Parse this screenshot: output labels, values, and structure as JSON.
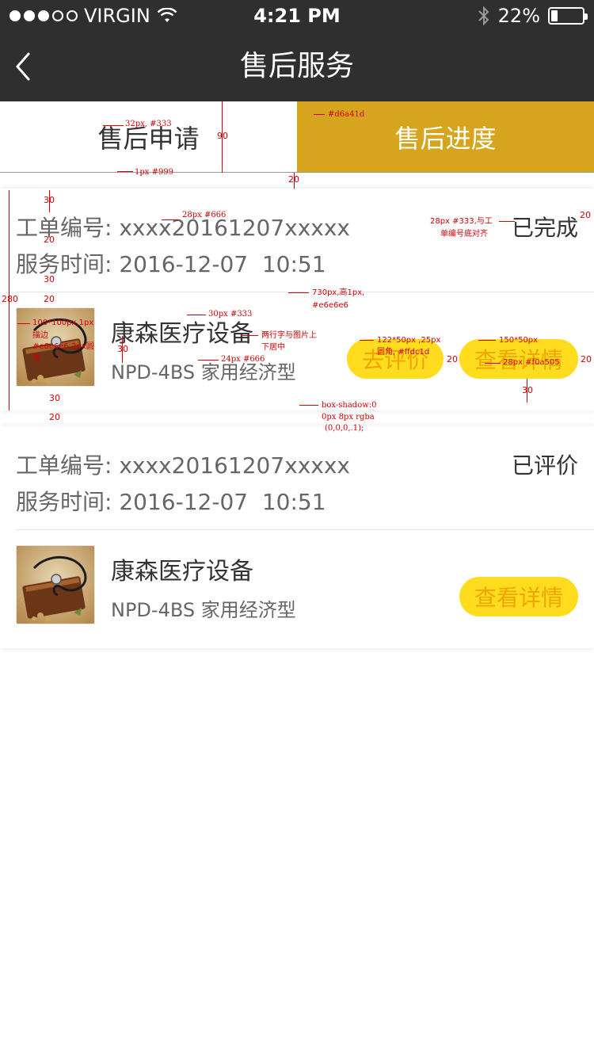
{
  "status_bar": {
    "carrier": "VIRGIN",
    "time": "4:21 PM",
    "battery": "22%",
    "battery_level": 0.22
  },
  "nav": {
    "title": "售后服务",
    "back_icon": "chevron-left-icon"
  },
  "tabs": [
    {
      "label": "售后申请",
      "active": false
    },
    {
      "label": "售后进度",
      "active": true
    }
  ],
  "orders": [
    {
      "order_no_label": "工单编号:",
      "order_no": "xxxx20161207xxxxx",
      "time_label": "服务时间:",
      "time": "2016-12-07  10:51",
      "status": "已完成",
      "product_name": "康森医疗设备",
      "product_model": "NPD-4BS 家用经济型",
      "review_button": "去评价",
      "detail_button": "查看详情"
    },
    {
      "order_no_label": "工单编号:",
      "order_no": "xxxx20161207xxxxx",
      "time_label": "服务时间:",
      "time": "2016-12-07  10:51",
      "status": "已评价",
      "product_name": "康森医疗设备",
      "product_model": "NPD-4BS 家用经济型",
      "detail_button": "查看详情"
    }
  ],
  "annotations": {
    "tab_text": "32px, #333",
    "tab_height": "90",
    "tab_bg": "#d6a41d",
    "tab_border": "1px #999",
    "gap_20": "20",
    "gap_30": "30",
    "card_height": "280",
    "order_text": "28px #666",
    "status_text": "28px #333,与工",
    "status_text_2": "单编号底对齐",
    "divider": "730px,高1px,",
    "divider_2": "#e6e6e6",
    "thumb": "100*100px,1px",
    "thumb_2": "描边",
    "thumb_3": "#e6e6e6,2px圆",
    "thumb_4": "角",
    "name_text": "30px #333",
    "two_line": "两行字与图片上",
    "two_line_2": "下居中",
    "model_text": "24px #666",
    "review_btn": "122*50px ,25px",
    "review_btn_2": "圆角, #ffdc1d",
    "detail_btn": "150*50px",
    "btn_text": "28px #f0a505",
    "shadow": "box-shadow:0",
    "shadow_2": "0px 8px rgba",
    "shadow_3": "(0,0,0,.1);",
    "right_20": "20"
  }
}
